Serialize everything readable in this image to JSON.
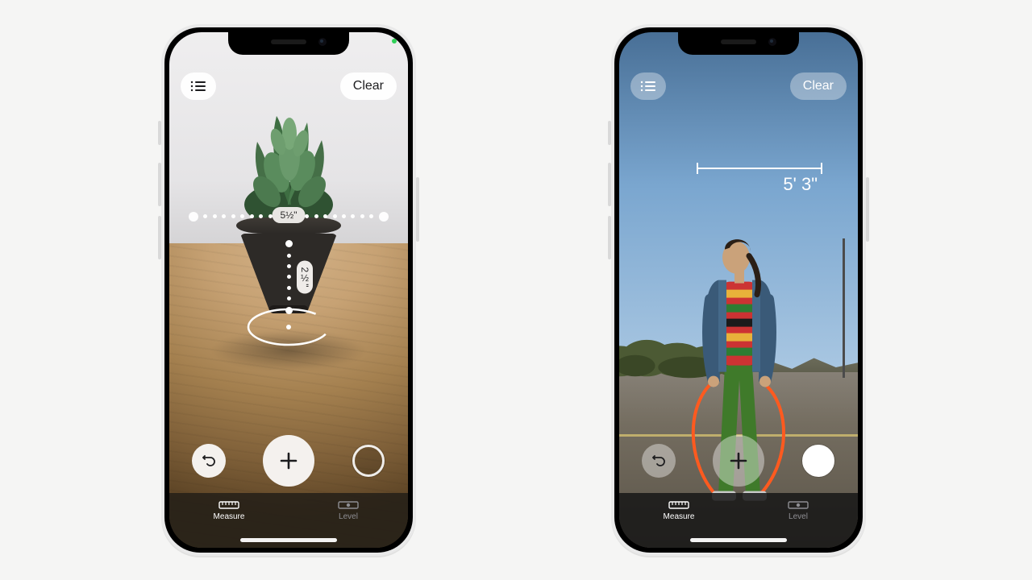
{
  "phones": {
    "left": {
      "list_button_icon": "list-icon",
      "clear_label": "Clear",
      "measure_width_label": "5½\"",
      "measure_height_label": "2½\"",
      "undo_icon": "undo-icon",
      "add_icon": "plus-icon",
      "shutter_icon": "shutter-icon",
      "tabs": {
        "measure": "Measure",
        "level": "Level"
      }
    },
    "right": {
      "list_button_icon": "list-icon",
      "clear_label": "Clear",
      "person_height_label": "5' 3\"",
      "undo_icon": "undo-icon",
      "add_icon": "plus-icon",
      "shutter_icon": "shutter-icon",
      "tabs": {
        "measure": "Measure",
        "level": "Level"
      }
    }
  }
}
